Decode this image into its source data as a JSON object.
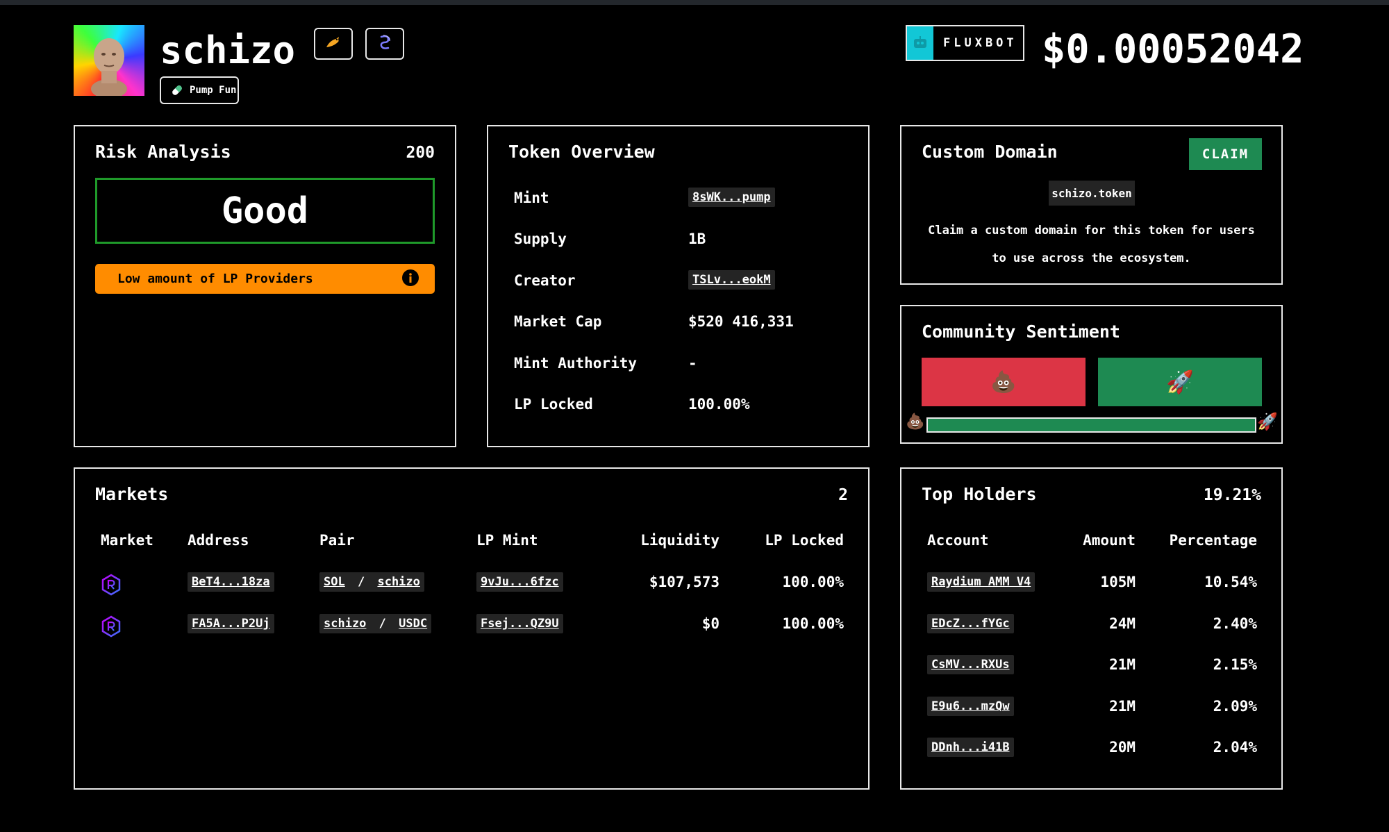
{
  "token": {
    "name": "schizo",
    "platform_label": "Pump Fun",
    "price": "$0.00052042"
  },
  "sponsor": {
    "label": "FLUXBOT"
  },
  "icons": {
    "avatar": "meme-face-avatar",
    "twitter": "bird-icon",
    "website": "spiral-icon",
    "pump": "pill-icon",
    "fluxbot": "robot-icon",
    "info": "info-icon",
    "raydium": "raydium-icon"
  },
  "colors": {
    "good_border": "#1f9a2a",
    "warning": "#ff8c00",
    "claim": "#1e8a52",
    "bearish": "#dc3545",
    "bullish": "#1e8a52"
  },
  "risk": {
    "title": "Risk Analysis",
    "score": "200",
    "verdict": "Good",
    "warning": "Low amount of LP Providers"
  },
  "overview": {
    "title": "Token Overview",
    "rows": [
      {
        "label": "Mint",
        "value": "8sWK...pump",
        "link": true
      },
      {
        "label": "Supply",
        "value": "1B",
        "link": false
      },
      {
        "label": "Creator",
        "value": "TSLv...eokM",
        "link": true
      },
      {
        "label": "Market Cap",
        "value": "$520 416,331",
        "link": false
      },
      {
        "label": "Mint Authority",
        "value": "-",
        "link": false
      },
      {
        "label": "LP Locked",
        "value": "100.00%",
        "link": false
      }
    ]
  },
  "domain": {
    "title": "Custom Domain",
    "claim_label": "CLAIM",
    "domain_name": "schizo.token",
    "description_line1": "Claim a custom domain for this token for users",
    "description_line2": "to use across the ecosystem."
  },
  "sentiment": {
    "title": "Community Sentiment",
    "bearish_emoji": "💩",
    "bullish_emoji": "🚀",
    "bullish_fraction": 1.0
  },
  "markets": {
    "title": "Markets",
    "count": "2",
    "headers": [
      "Market",
      "Address",
      "Pair",
      "LP Mint",
      "Liquidity",
      "LP Locked"
    ],
    "rows": [
      {
        "address": "BeT4...18za",
        "pair_base": "SOL",
        "pair_sep": "/",
        "pair_quote": "schizo",
        "lp_mint": "9vJu...6fzc",
        "liquidity": "$107,573",
        "lp_locked": "100.00%"
      },
      {
        "address": "FA5A...P2Uj",
        "pair_base": "schizo",
        "pair_sep": "/",
        "pair_quote": "USDC",
        "lp_mint": "Fsej...QZ9U",
        "liquidity": "$0",
        "lp_locked": "100.00%"
      }
    ]
  },
  "holders": {
    "title": "Top Holders",
    "total": "19.21%",
    "headers": [
      "Account",
      "Amount",
      "Percentage"
    ],
    "rows": [
      {
        "account": "Raydium AMM V4",
        "amount": "105M",
        "percentage": "10.54%"
      },
      {
        "account": "EDcZ...fYGc",
        "amount": "24M",
        "percentage": "2.40%"
      },
      {
        "account": "CsMV...RXUs",
        "amount": "21M",
        "percentage": "2.15%"
      },
      {
        "account": "E9u6...mzQw",
        "amount": "21M",
        "percentage": "2.09%"
      },
      {
        "account": "DDnh...i41B",
        "amount": "20M",
        "percentage": "2.04%"
      }
    ]
  }
}
